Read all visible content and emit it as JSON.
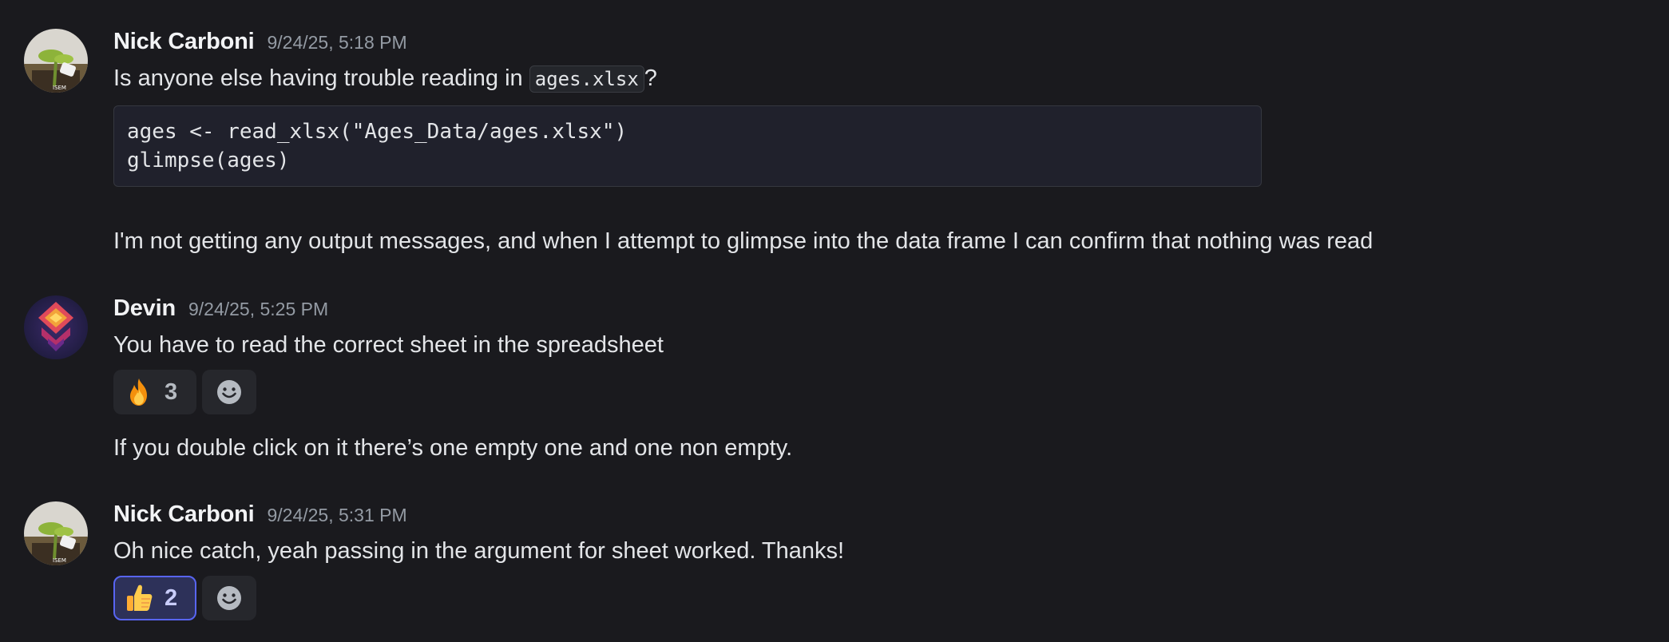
{
  "messages": [
    {
      "username": "Nick Carboni",
      "timestamp": "9/24/25, 5:18 PM",
      "line1_prefix": "Is anyone else having trouble reading in ",
      "line1_code": "ages.xlsx",
      "line1_suffix": "?",
      "code_lines": [
        "ages <- read_xlsx(\"Ages_Data/ages.xlsx\")",
        "glimpse(ages)"
      ],
      "followup": "I'm not getting any output messages, and when I attempt to glimpse into the data frame I can confirm that nothing was read"
    },
    {
      "username": "Devin",
      "timestamp": "9/24/25, 5:25 PM",
      "text": "You have to read the correct sheet in the spreadsheet",
      "reaction": {
        "emoji": "fire-emoji",
        "count": "3"
      },
      "followup": "If you double click on it there’s one empty one and one non empty."
    },
    {
      "username": "Nick Carboni",
      "timestamp": "9/24/25, 5:31 PM",
      "text": "Oh nice catch, yeah passing in the argument for sheet worked. Thanks!",
      "reaction": {
        "emoji": "thumbs-up-emoji",
        "count": "2",
        "reacted_by_me": true
      }
    }
  ],
  "colors": {
    "background": "#1a1a1e",
    "accent": "#5865f2",
    "username": "#f2f3f5",
    "timestamp": "#949ba4"
  }
}
